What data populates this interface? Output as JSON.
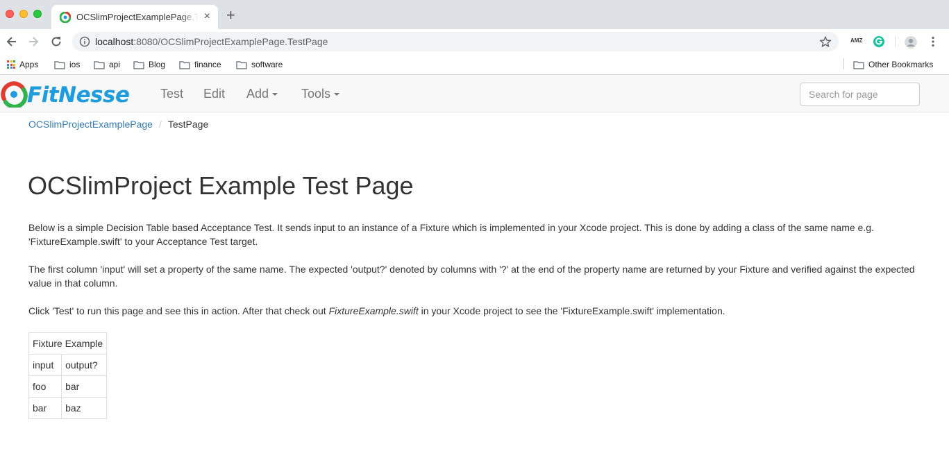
{
  "browser": {
    "tab_title": "OCSlimProjectExamplePage.TestPage",
    "tab_close": "×",
    "new_tab": "+",
    "url_host": "localhost",
    "url_rest": ":8080/OCSlimProjectExamplePage.TestPage",
    "bookmarks": [
      "Apps",
      "ios",
      "api",
      "Blog",
      "finance",
      "software"
    ],
    "other_bookmarks": "Other Bookmarks",
    "ext_amz": "AMZ"
  },
  "fitnesse": {
    "logo": "FitNesse",
    "nav": {
      "test": "Test",
      "edit": "Edit",
      "add": "Add",
      "tools": "Tools"
    },
    "search_placeholder": "Search for page"
  },
  "breadcrumb": {
    "parent": "OCSlimProjectExamplePage",
    "separator": "/",
    "current": "TestPage"
  },
  "content": {
    "title": "OCSlimProject Example Test Page",
    "para1": "Below is a simple Decision Table based Acceptance Test. It sends input to an instance of a Fixture which is implemented in your Xcode project. This is done by adding a class of the same name e.g. 'FixtureExample.swift' to your Acceptance Test target.",
    "para2": "The first column 'input' will set a property of the same name. The expected 'output?' denoted by columns with '?' at the end of the property name are returned by your Fixture and verified against the expected value in that column.",
    "para3_before": "Click 'Test' to run this page and see this in action. After that check out ",
    "para3_em": "FixtureExample.swift",
    "para3_after": " in your Xcode project to see the 'FixtureExample.swift' implementation."
  },
  "table": {
    "title": "Fixture Example",
    "headers": [
      "input",
      "output?"
    ],
    "rows": [
      [
        "foo",
        "bar"
      ],
      [
        "bar",
        "baz"
      ]
    ]
  }
}
